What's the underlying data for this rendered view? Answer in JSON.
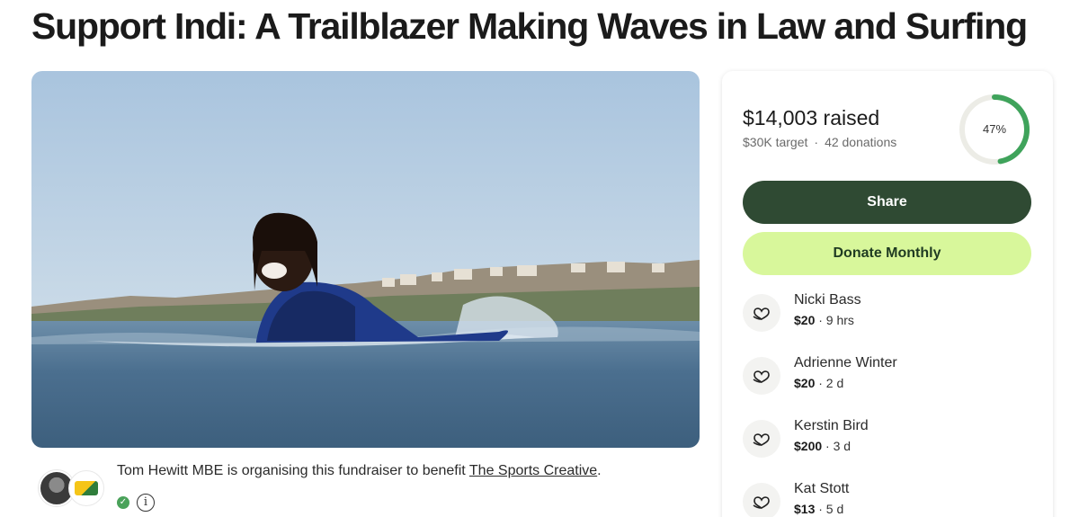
{
  "page": {
    "title": "Support Indi: A Trailblazer Making Waves in Law and Surfing"
  },
  "organiser": {
    "name": "Tom Hewitt MBE",
    "text": " is organising this fundraiser to benefit ",
    "beneficiary": "The Sports Creative",
    "suffix": "."
  },
  "stats": {
    "raised": "$14,003 raised",
    "target": "$30K target",
    "separator": "·",
    "donations": "42 donations",
    "percent": "47%",
    "progress_fraction": 0.47
  },
  "buttons": {
    "share": "Share",
    "donate_monthly": "Donate Monthly"
  },
  "donors": [
    {
      "name": "Nicki Bass",
      "amount": "$20",
      "time": " · 9 hrs"
    },
    {
      "name": "Adrienne Winter",
      "amount": "$20",
      "time": " · 2 d"
    },
    {
      "name": "Kerstin Bird",
      "amount": "$200",
      "time": " · 3 d"
    },
    {
      "name": "Kat Stott",
      "amount": "$13",
      "time": " · 5 d"
    }
  ],
  "colors": {
    "share_bg": "#2f4a33",
    "monthly_bg": "#d8f79b",
    "progress": "#3fa35b",
    "progress_track": "#ecece6"
  },
  "icons": {
    "donor": "heart-hand-icon",
    "verified": "check-circle-icon",
    "info": "info-icon"
  }
}
